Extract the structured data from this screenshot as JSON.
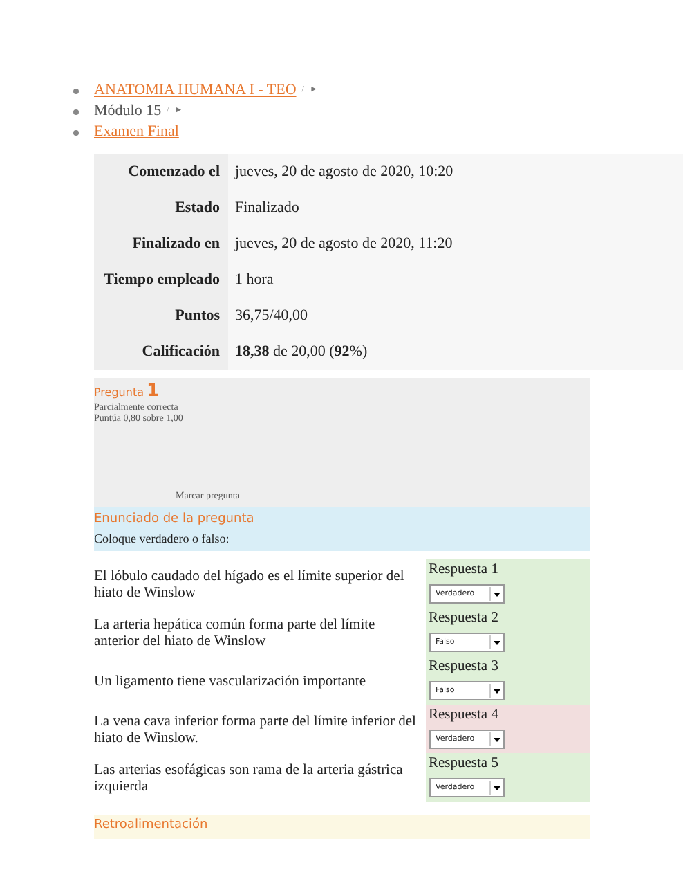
{
  "breadcrumb": [
    {
      "label": "ANATOMIA HUMANA I - TEO",
      "link": true,
      "separator": "/",
      "arrow": "►"
    },
    {
      "label": "Módulo 15",
      "link": false,
      "separator": "/",
      "arrow": "►"
    },
    {
      "label": "Examen Final",
      "link": true
    }
  ],
  "summary": [
    {
      "label": "Comenzado el",
      "value": "jueves, 20 de agosto de 2020, 10:20"
    },
    {
      "label": "Estado",
      "value": "Finalizado"
    },
    {
      "label": "Finalizado en",
      "value": "jueves, 20 de agosto de 2020, 11:20"
    },
    {
      "label": "Tiempo empleado",
      "value": "1 hora"
    },
    {
      "label": "Puntos",
      "value": "36,75/40,00"
    },
    {
      "label": "Calificación",
      "value": "**18,38** de 20,00 (**92**%)"
    }
  ],
  "question": {
    "title": "Pregunta",
    "number": "1",
    "status": "Parcialmente correcta",
    "score": "Puntúa 0,80 sobre 1,00",
    "flag": "Marcar pregunta",
    "statement_heading": "Enunciado de la pregunta",
    "instruction": "Coloque verdadero o falso:",
    "items": [
      {
        "text": "El lóbulo caudado del hígado es el límite superior del hiato de Winslow",
        "answer_label": "Respuesta 1",
        "value": "Verdadero",
        "correct": true
      },
      {
        "text": "La arteria hepática común forma parte del límite anterior del hiato de Winslow",
        "answer_label": "Respuesta 2",
        "value": "Falso",
        "correct": true
      },
      {
        "text": "Un ligamento tiene vascularización importante",
        "answer_label": "Respuesta 3",
        "value": "Falso",
        "correct": true
      },
      {
        "text": "La vena cava inferior forma parte del límite inferior del hiato de Winslow.",
        "answer_label": "Respuesta 4",
        "value": "Verdadero",
        "correct": false
      },
      {
        "text": "Las arterias esofágicas son rama de la arteria gástrica izquierda",
        "answer_label": "Respuesta 5",
        "value": "Verdadero",
        "correct": true
      }
    ],
    "feedback_heading": "Retroalimentación"
  }
}
